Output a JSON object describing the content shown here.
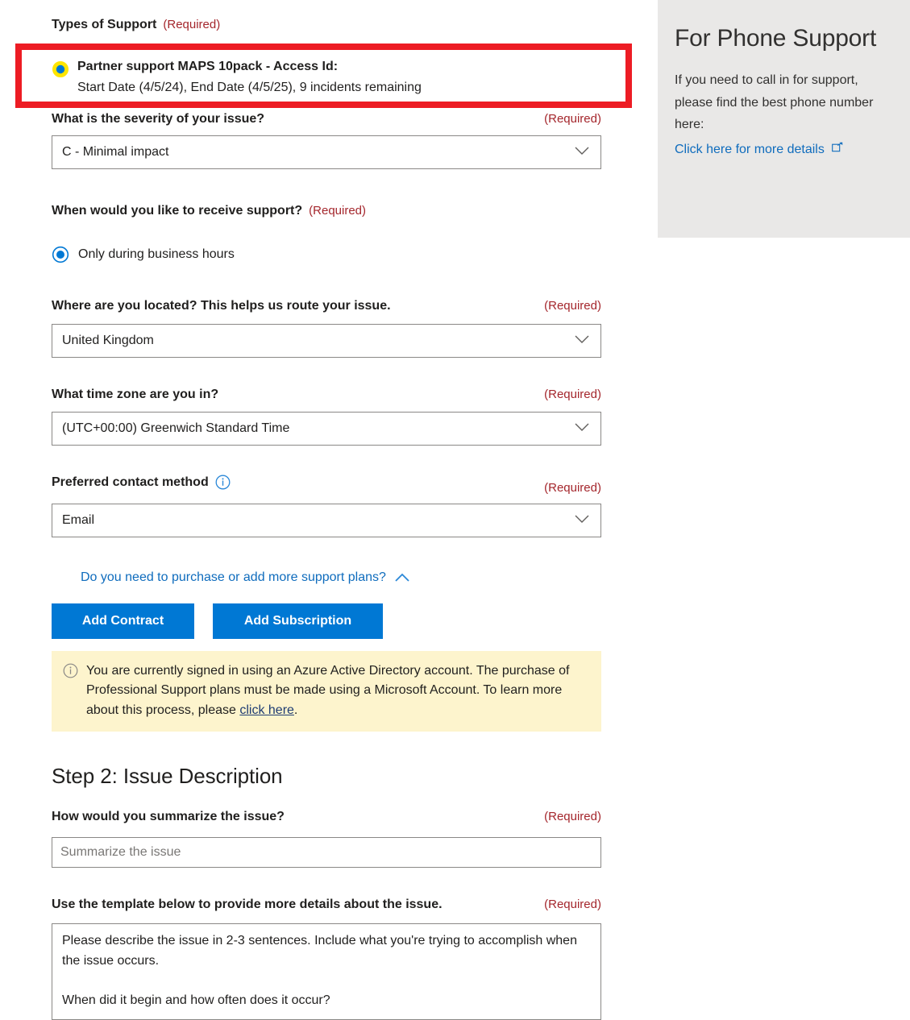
{
  "form": {
    "types_of_support": {
      "label": "Types of Support",
      "required": "(Required)",
      "option": {
        "title": "Partner support MAPS 10pack - Access Id:",
        "detail": "Start Date (4/5/24), End Date (4/5/25), 9 incidents remaining",
        "selected": true
      }
    },
    "severity": {
      "label": "What is the severity of your issue?",
      "required": "(Required)",
      "value": "C - Minimal impact"
    },
    "receive_support": {
      "label": "When would you like to receive support?",
      "required": "(Required)",
      "option": "Only during business hours"
    },
    "location": {
      "label": "Where are you located? This helps us route your issue.",
      "required": "(Required)",
      "value": "United Kingdom"
    },
    "timezone": {
      "label": "What time zone are you in?",
      "required": "(Required)",
      "value": "(UTC+00:00) Greenwich Standard Time"
    },
    "contact_method": {
      "label": "Preferred contact method",
      "required": "(Required)",
      "value": "Email",
      "info_icon": "info-icon"
    },
    "plans": {
      "link": "Do you need to purchase or add more support plans?",
      "collapse_icon": "chevron-up-icon",
      "add_contract": "Add Contract",
      "add_subscription": "Add Subscription"
    },
    "notice": {
      "icon": "info-icon",
      "text_before": "You are currently signed in using an Azure Active Directory account. The purchase of Professional Support plans must be made using a Microsoft Account. To learn more about this process, please ",
      "link": "click here",
      "text_after": "."
    },
    "step2": {
      "heading": "Step 2: Issue Description",
      "summary": {
        "label": "How would you summarize the issue?",
        "required": "(Required)",
        "placeholder": "Summarize the issue",
        "value": ""
      },
      "template": {
        "label": "Use the template below to provide more details about the issue.",
        "required": "(Required)",
        "value": "Please describe the issue in 2-3 sentences. Include what you're trying to accomplish when the issue occurs.\n\nWhen did it begin and how often does it occur?"
      }
    }
  },
  "phone_panel": {
    "title": "For Phone Support",
    "body": "If you need to call in for support, please find the best phone number here:",
    "link": "Click here for more details",
    "link_icon": "external-link-icon"
  },
  "colors": {
    "accent_blue": "#0078d4",
    "link_blue": "#0f6cbd",
    "required_red": "#a4262c",
    "highlight_red": "#ed1c24",
    "radio_highlight_yellow": "#ffe500",
    "notice_yellow": "#fdf4cd",
    "panel_gray": "#e9e8e7"
  }
}
